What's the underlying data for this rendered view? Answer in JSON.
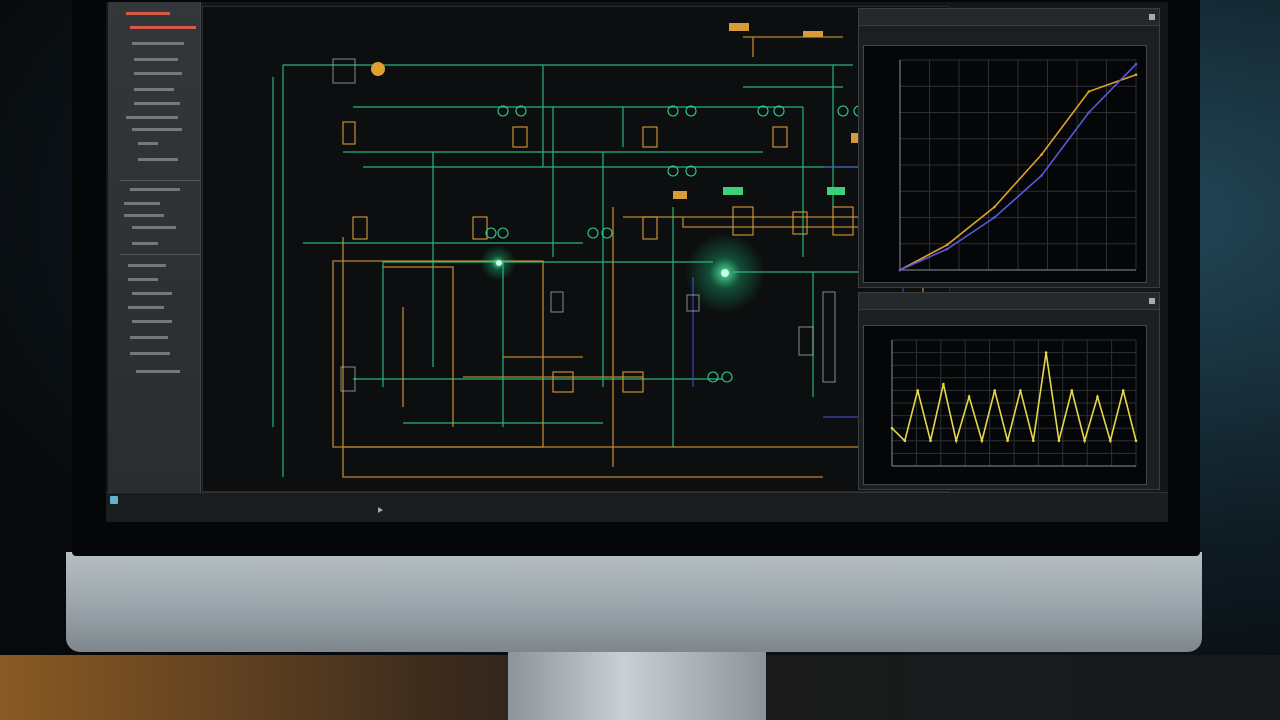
{
  "colors": {
    "wire_green": "#2fd08a",
    "wire_orange": "#d99a3a",
    "wire_blue": "#4a4fd0",
    "plot_yellow": "#e6d84a",
    "plot_orange": "#e0a030",
    "plot_blue": "#5a58e0"
  },
  "icons": [
    "cursor-icon",
    "status-indicator-icon",
    "window-close-icon"
  ],
  "panels": {
    "top": {
      "title": "",
      "controls": "",
      "subtitle": ""
    },
    "bottom": {
      "title": "",
      "controls": "",
      "subtitle": ""
    }
  },
  "statusbar": {
    "text": ""
  },
  "chart_data": [
    {
      "type": "line",
      "title": "",
      "xlabel": "",
      "ylabel": "",
      "grid": true,
      "series": [
        {
          "values": [
            0.0,
            0.12,
            0.3,
            0.55,
            0.85,
            0.93
          ]
        },
        {
          "values": [
            0.0,
            0.1,
            0.25,
            0.45,
            0.75,
            0.98
          ]
        }
      ]
    },
    {
      "type": "line",
      "title": "",
      "xlabel": "",
      "ylabel": "",
      "grid": true,
      "series": [
        {
          "values": [
            0.3,
            0.2,
            0.6,
            0.2,
            0.65,
            0.2,
            0.55,
            0.2,
            0.6,
            0.2,
            0.6,
            0.2,
            0.9,
            0.2,
            0.6,
            0.2,
            0.55,
            0.2,
            0.6,
            0.2
          ]
        }
      ]
    }
  ]
}
